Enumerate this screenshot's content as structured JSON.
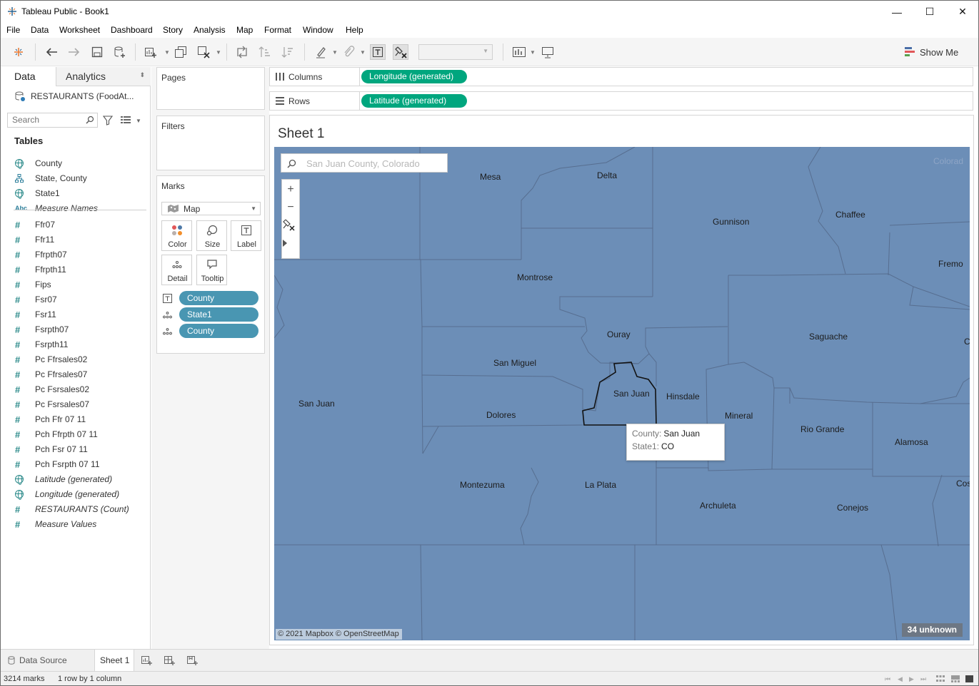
{
  "window": {
    "title": "Tableau Public - Book1",
    "minimize": "—",
    "maximize": "☐",
    "close": "✕"
  },
  "menu": [
    "File",
    "Data",
    "Worksheet",
    "Dashboard",
    "Story",
    "Analysis",
    "Map",
    "Format",
    "Window",
    "Help"
  ],
  "toolbar": {
    "show_me": "Show Me",
    "fit_value": ""
  },
  "data_pane": {
    "tab_data": "Data",
    "tab_analytics": "Analytics",
    "datasource": "RESTAURANTS (FoodAt...",
    "search_placeholder": "Search",
    "tables_title": "Tables",
    "dimensions": [
      {
        "name": "County",
        "icon": "globe-icon"
      },
      {
        "name": "State, County",
        "icon": "hierarchy-icon"
      },
      {
        "name": "State1",
        "icon": "globe-icon"
      },
      {
        "name": "Measure Names",
        "icon": "abc-icon"
      }
    ],
    "measures": [
      {
        "name": "Ffr07",
        "icon": "hash-icon"
      },
      {
        "name": "Ffr11",
        "icon": "hash-icon"
      },
      {
        "name": "Ffrpth07",
        "icon": "hash-icon"
      },
      {
        "name": "Ffrpth11",
        "icon": "hash-icon"
      },
      {
        "name": "Fips",
        "icon": "hash-icon"
      },
      {
        "name": "Fsr07",
        "icon": "hash-icon"
      },
      {
        "name": "Fsr11",
        "icon": "hash-icon"
      },
      {
        "name": "Fsrpth07",
        "icon": "hash-icon"
      },
      {
        "name": "Fsrpth11",
        "icon": "hash-icon"
      },
      {
        "name": "Pc Ffrsales02",
        "icon": "hash-icon"
      },
      {
        "name": "Pc Ffrsales07",
        "icon": "hash-icon"
      },
      {
        "name": "Pc Fsrsales02",
        "icon": "hash-icon"
      },
      {
        "name": "Pc Fsrsales07",
        "icon": "hash-icon"
      },
      {
        "name": "Pch Ffr 07 11",
        "icon": "hash-icon"
      },
      {
        "name": "Pch Ffrpth 07 11",
        "icon": "hash-icon"
      },
      {
        "name": "Pch Fsr 07 11",
        "icon": "hash-icon"
      },
      {
        "name": "Pch Fsrpth 07 11",
        "icon": "hash-icon"
      },
      {
        "name": "Latitude (generated)",
        "icon": "globe-icon"
      },
      {
        "name": "Longitude (generated)",
        "icon": "globe-icon"
      },
      {
        "name": "RESTAURANTS (Count)",
        "icon": "hash-icon"
      },
      {
        "name": "Measure Values",
        "icon": "hash-icon"
      }
    ]
  },
  "cards": {
    "pages": "Pages",
    "filters": "Filters",
    "marks": "Marks",
    "mark_type": "Map",
    "buttons": {
      "color": "Color",
      "size": "Size",
      "label": "Label",
      "detail": "Detail",
      "tooltip": "Tooltip"
    },
    "mark_pills": [
      "County",
      "State1",
      "County"
    ]
  },
  "shelves": {
    "columns_label": "Columns",
    "columns_pill": "Longitude (generated)",
    "rows_label": "Rows",
    "rows_pill": "Latitude (generated)"
  },
  "sheet": {
    "title": "Sheet 1",
    "map_search_placeholder": "San Juan County, Colorado",
    "counties": [
      "Mesa",
      "Delta",
      "Gunnison",
      "Chaffee",
      "Fremo",
      "Montrose",
      "Ouray",
      "Saguache",
      "C",
      "San Miguel",
      "San Juan",
      "Hinsdale",
      "San Juan",
      "Dolores",
      "Mineral",
      "Rio Grande",
      "Alamosa",
      "Montezuma",
      "La Plata",
      "Archuleta",
      "Conejos",
      "Costil",
      "Colorad"
    ],
    "tooltip": {
      "county_key": "County:",
      "county_val": "San Juan",
      "state_key": "State1:",
      "state_val": "CO"
    },
    "attribution": "© 2021 Mapbox © OpenStreetMap",
    "unknown": "34 unknown",
    "map_color": "#6c8eb7"
  },
  "bottom_tabs": {
    "datasource": "Data Source",
    "sheet": "Sheet 1"
  },
  "status": {
    "marks": "3214 marks",
    "layout": "1 row by 1 column"
  }
}
